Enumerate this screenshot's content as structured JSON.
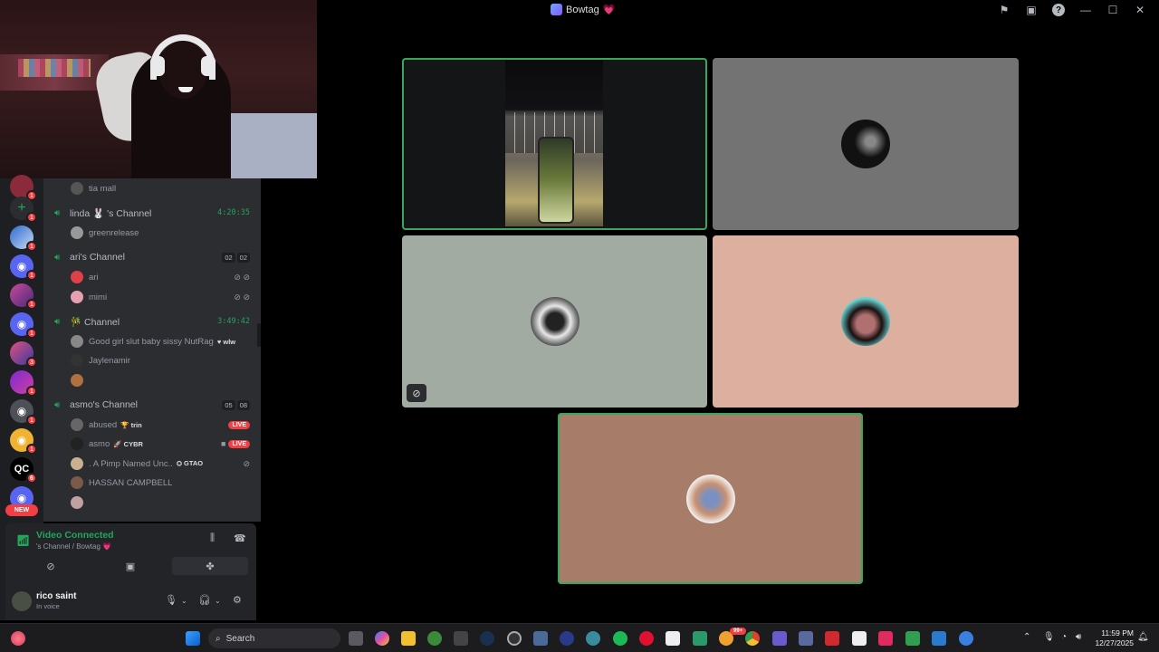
{
  "window": {
    "title": "Bowtag",
    "title_emoji": "💗"
  },
  "titlebar_icons": [
    "inbox-flag-icon",
    "screen-share-icon",
    "help-icon",
    "minimize-icon",
    "maximize-icon",
    "close-icon"
  ],
  "servers": [
    {
      "badge": "1"
    },
    {
      "badge": "1"
    },
    {
      "badge": "1"
    },
    {
      "badge": "1"
    },
    {
      "badge": "1"
    },
    {
      "badge": "1"
    },
    {
      "badge": "3"
    },
    {
      "badge": "1"
    },
    {
      "badge": "1"
    },
    {
      "badge": "1"
    },
    {
      "badge": "1"
    },
    {
      "badge": "6"
    },
    {
      "badge": "NEW"
    }
  ],
  "channels": {
    "top_member": "tia mall",
    "groups": [
      {
        "name": "linda 🐰 's Channel",
        "timer": "4:20:35",
        "members": [
          "greenrelease"
        ]
      },
      {
        "name": "ari's Channel",
        "counts": [
          "02",
          "02"
        ],
        "members": [
          "ari",
          "mimi"
        ]
      },
      {
        "name": "🎋 Channel",
        "timer": "3:49:42",
        "members": [
          "Good girl slut baby sissy NutRag",
          "Jaylenamir",
          ""
        ],
        "member_tag": "wlw"
      },
      {
        "name": "asmo's Channel",
        "counts": [
          "05",
          "08"
        ],
        "members": [
          "abused",
          "asmo",
          ". A Pimp Named Unc..",
          "HASSAN CAMPBELL",
          ""
        ],
        "tags": {
          "abused": "trin",
          "asmo": "CYBR",
          "pimp": "GTAO"
        },
        "live_label": "LIVE"
      }
    ]
  },
  "voice": {
    "status": "Video Connected",
    "channel": "'s Channel / Bowtag 💗"
  },
  "user": {
    "name": "rico saint",
    "status": "In voice"
  },
  "taskbar": {
    "search_placeholder": "Search",
    "time": "11:59 PM",
    "date": "12/27/2025",
    "badge": "99+"
  }
}
